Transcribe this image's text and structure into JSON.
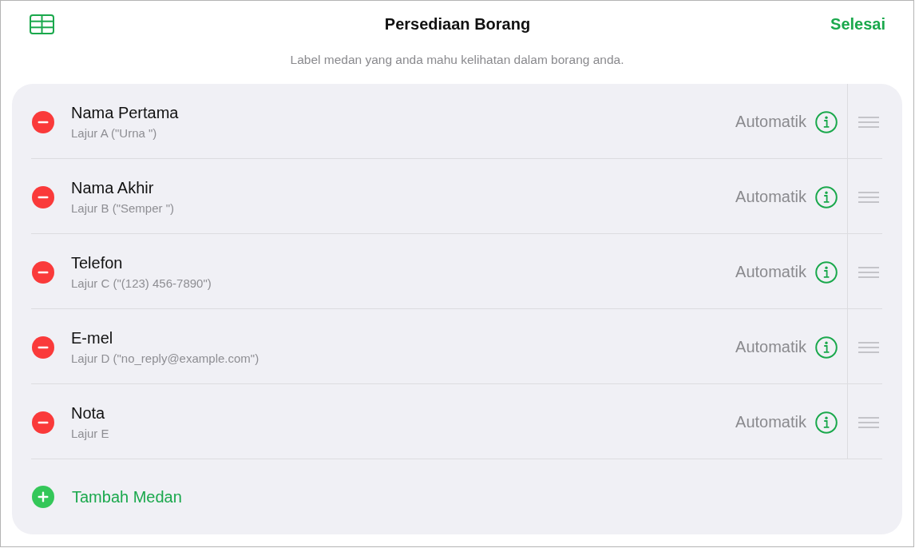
{
  "header": {
    "title": "Persediaan Borang",
    "done_button": "Selesai",
    "subtitle": "Label medan yang anda mahu kelihatan dalam borang anda."
  },
  "fields": [
    {
      "label": "Nama Pertama",
      "source": "Lajur A (\"Urna \")",
      "format": "Automatik"
    },
    {
      "label": "Nama Akhir",
      "source": "Lajur B (\"Semper \")",
      "format": "Automatik"
    },
    {
      "label": "Telefon",
      "source": "Lajur C (\"(123) 456-7890\")",
      "format": "Automatik"
    },
    {
      "label": "E-mel",
      "source": "Lajur D (\"no_reply@example.com\")",
      "format": "Automatik"
    },
    {
      "label": "Nota",
      "source": "Lajur E",
      "format": "Automatik"
    }
  ],
  "add_button": "Tambah Medan"
}
